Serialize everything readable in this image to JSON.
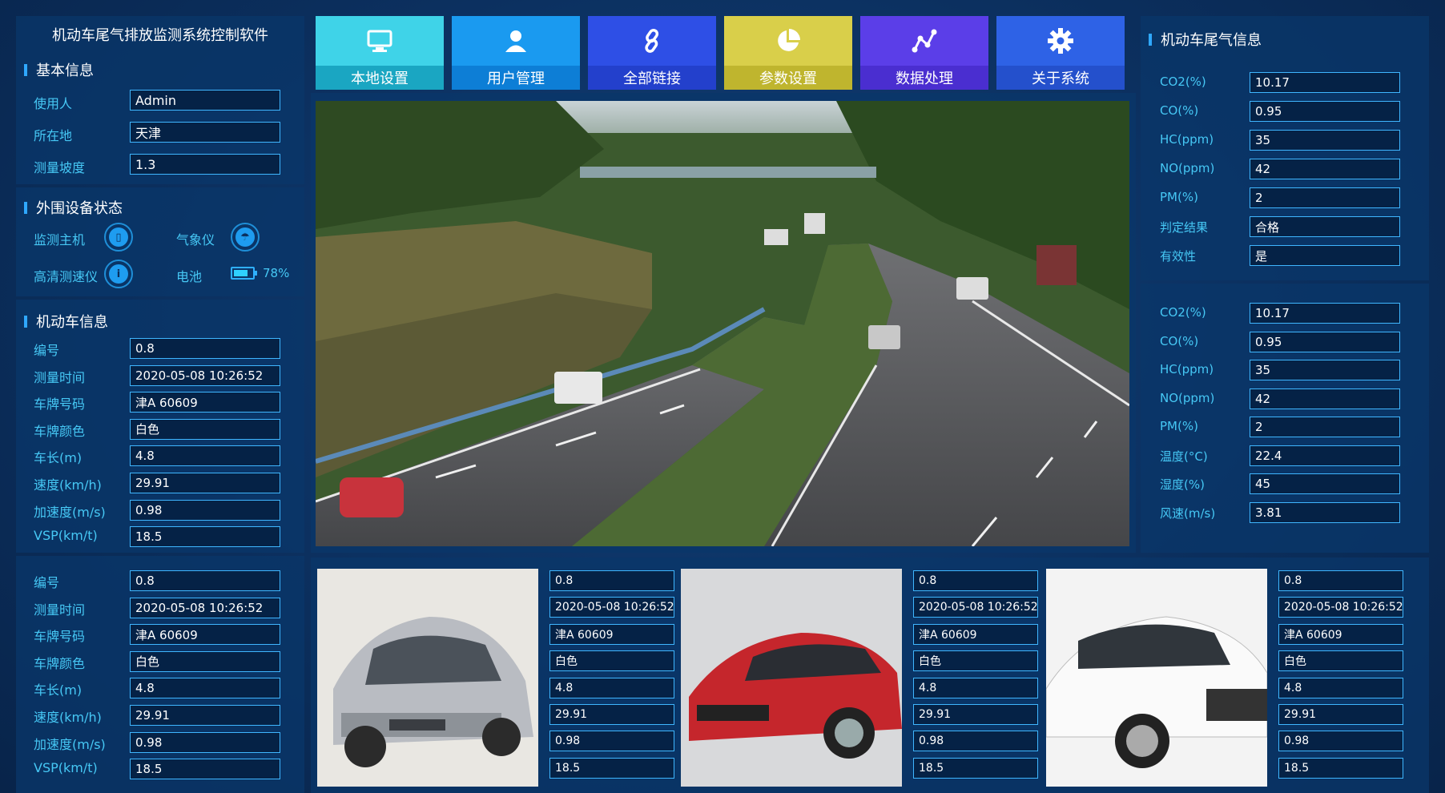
{
  "app_title": "机动车尾气排放监测系统控制软件",
  "basic": {
    "header": "基本信息",
    "fields": [
      {
        "label": "使用人",
        "value": "Admin"
      },
      {
        "label": "所在地",
        "value": "天津"
      },
      {
        "label": "测量坡度",
        "value": "1.3"
      }
    ]
  },
  "devices": {
    "header": "外围设备状态",
    "items": [
      {
        "label": "监测主机",
        "icon": "host-device-icon"
      },
      {
        "label": "气象仪",
        "icon": "weather-station-icon"
      },
      {
        "label": "高清测速仪",
        "icon": "speed-camera-icon"
      },
      {
        "label": "电池",
        "icon": "battery-icon",
        "value": "78%",
        "level": 0.78
      }
    ]
  },
  "vehicle": {
    "header": "机动车信息",
    "labels": [
      "编号",
      "测量时间",
      "车牌号码",
      "车牌颜色",
      "车长(m)",
      "速度(km/h)",
      "加速度(m/s)",
      "VSP(km/t)"
    ],
    "records": [
      [
        "0.8",
        "2020-05-08  10:26:52",
        "津A 60609",
        "白色",
        "4.8",
        "29.91",
        "0.98",
        "18.5"
      ],
      [
        "0.8",
        "2020-05-08  10:26:52",
        "津A 60609",
        "白色",
        "4.8",
        "29.91",
        "0.98",
        "18.5"
      ]
    ]
  },
  "nav": [
    {
      "label": "本地设置",
      "icon": "monitor-icon",
      "top": "#3fd3e8",
      "bot": "#1aa6c2"
    },
    {
      "label": "用户管理",
      "icon": "user-icon",
      "top": "#1a9af0",
      "bot": "#0d7ed6"
    },
    {
      "label": "全部链接",
      "icon": "link-icon",
      "top": "#2e4fe6",
      "bot": "#2340cc"
    },
    {
      "label": "参数设置",
      "icon": "pie-chart-icon",
      "top": "#d9cf4a",
      "bot": "#bfb52e"
    },
    {
      "label": "数据处理",
      "icon": "graph-nodes-icon",
      "top": "#5b3ee8",
      "bot": "#4a2ed0"
    },
    {
      "label": "关于系统",
      "icon": "gear-icon",
      "top": "#2e62e6",
      "bot": "#2450cc"
    }
  ],
  "exhaust": {
    "header": "机动车尾气信息",
    "block1": [
      {
        "label": "CO2(%)",
        "value": "10.17"
      },
      {
        "label": "CO(%)",
        "value": "0.95"
      },
      {
        "label": "HC(ppm)",
        "value": "35"
      },
      {
        "label": "NO(ppm)",
        "value": "42"
      },
      {
        "label": "PM(%)",
        "value": "2"
      },
      {
        "label": "判定结果",
        "value": "合格"
      },
      {
        "label": "有效性",
        "value": "是"
      }
    ],
    "block2": [
      {
        "label": "CO2(%)",
        "value": "10.17"
      },
      {
        "label": "CO(%)",
        "value": "0.95"
      },
      {
        "label": "HC(ppm)",
        "value": "35"
      },
      {
        "label": "NO(ppm)",
        "value": "42"
      },
      {
        "label": "PM(%)",
        "value": "2"
      },
      {
        "label": "温度(°C)",
        "value": "22.4"
      },
      {
        "label": "湿度(%)",
        "value": "45"
      },
      {
        "label": "风速(m/s)",
        "value": "3.81"
      }
    ]
  },
  "gallery": [
    {
      "car": "silver-sedan",
      "values": [
        "0.8",
        "2020-05-08  10:26:52",
        "津A 60609",
        "白色",
        "4.8",
        "29.91",
        "0.98",
        "18.5"
      ]
    },
    {
      "car": "red-sedan",
      "values": [
        "0.8",
        "2020-05-08  10:26:52",
        "津A 60609",
        "白色",
        "4.8",
        "29.91",
        "0.98",
        "18.5"
      ]
    },
    {
      "car": "white-coupe",
      "values": [
        "0.8",
        "2020-05-08  10:26:52",
        "津A 60609",
        "白色",
        "4.8",
        "29.91",
        "0.98",
        "18.5"
      ]
    }
  ]
}
